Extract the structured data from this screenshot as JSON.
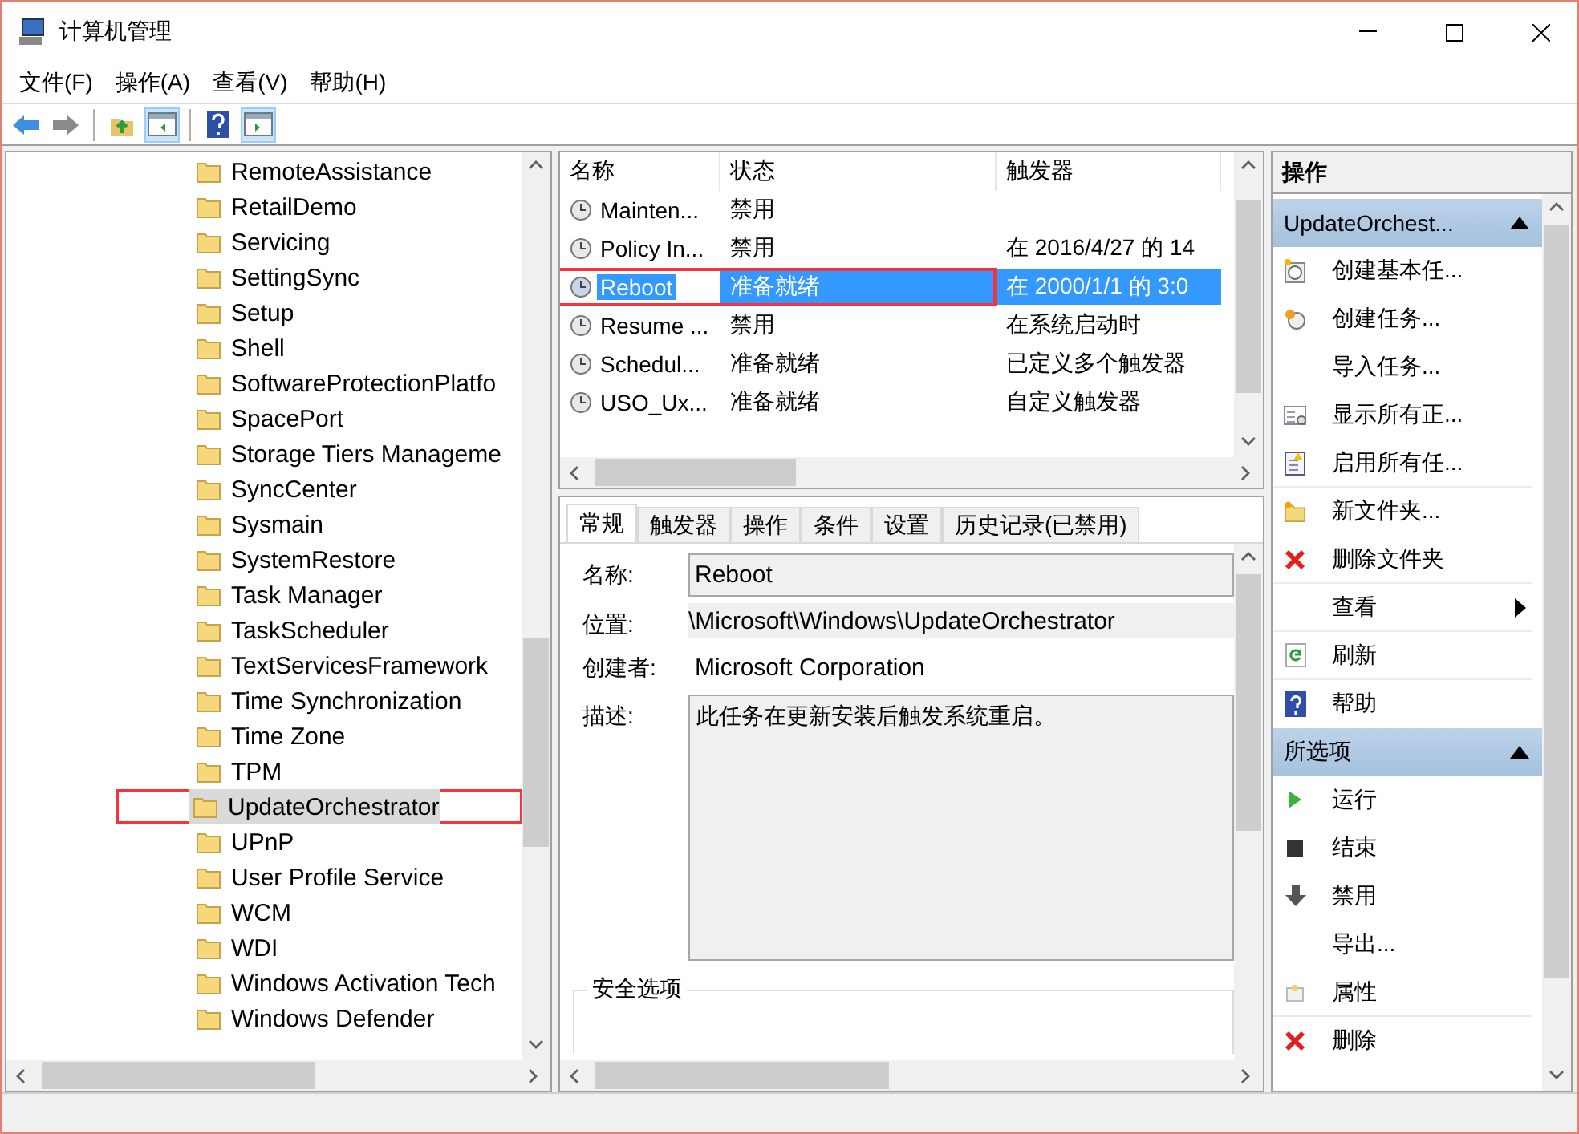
{
  "window": {
    "title": "计算机管理"
  },
  "menu": [
    "文件(F)",
    "操作(A)",
    "查看(V)",
    "帮助(H)"
  ],
  "toolbar": [
    {
      "pressed": false
    },
    {
      "pressed": false
    },
    {
      "pressed": false
    },
    {
      "pressed": true
    },
    {
      "pressed": false
    },
    {
      "pressed": true
    }
  ],
  "tree": {
    "items": [
      {
        "label": "RemoteAssistance",
        "selected": false,
        "annotated": false
      },
      {
        "label": "RetailDemo",
        "selected": false,
        "annotated": false
      },
      {
        "label": "Servicing",
        "selected": false,
        "annotated": false
      },
      {
        "label": "SettingSync",
        "selected": false,
        "annotated": false
      },
      {
        "label": "Setup",
        "selected": false,
        "annotated": false
      },
      {
        "label": "Shell",
        "selected": false,
        "annotated": false
      },
      {
        "label": "SoftwareProtectionPlatfo",
        "selected": false,
        "annotated": false
      },
      {
        "label": "SpacePort",
        "selected": false,
        "annotated": false
      },
      {
        "label": "Storage Tiers Manageme",
        "selected": false,
        "annotated": false
      },
      {
        "label": "SyncCenter",
        "selected": false,
        "annotated": false
      },
      {
        "label": "Sysmain",
        "selected": false,
        "annotated": false
      },
      {
        "label": "SystemRestore",
        "selected": false,
        "annotated": false
      },
      {
        "label": "Task Manager",
        "selected": false,
        "annotated": false
      },
      {
        "label": "TaskScheduler",
        "selected": false,
        "annotated": false
      },
      {
        "label": "TextServicesFramework",
        "selected": false,
        "annotated": false
      },
      {
        "label": "Time Synchronization",
        "selected": false,
        "annotated": false
      },
      {
        "label": "Time Zone",
        "selected": false,
        "annotated": false
      },
      {
        "label": "TPM",
        "selected": false,
        "annotated": false
      },
      {
        "label": "UpdateOrchestrator",
        "selected": true,
        "annotated": true
      },
      {
        "label": "UPnP",
        "selected": false,
        "annotated": false
      },
      {
        "label": "User Profile Service",
        "selected": false,
        "annotated": false
      },
      {
        "label": "WCM",
        "selected": false,
        "annotated": false
      },
      {
        "label": "WDI",
        "selected": false,
        "annotated": false
      },
      {
        "label": "Windows Activation Tech",
        "selected": false,
        "annotated": false
      },
      {
        "label": "Windows Defender",
        "selected": false,
        "annotated": false
      }
    ]
  },
  "task_list": {
    "columns": [
      "名称",
      "状态",
      "触发器"
    ],
    "rows": [
      {
        "name": "Mainten...",
        "status": "禁用",
        "trigger": "",
        "selected": false,
        "annotated": false
      },
      {
        "name": "Policy In...",
        "status": "禁用",
        "trigger": "在 2016/4/27 的 14",
        "selected": false,
        "annotated": false
      },
      {
        "name": "Reboot",
        "status": "准备就绪",
        "trigger": "在 2000/1/1 的 3:0",
        "selected": true,
        "annotated": true
      },
      {
        "name": "Resume ...",
        "status": "禁用",
        "trigger": "在系统启动时",
        "selected": false,
        "annotated": false
      },
      {
        "name": "Schedul...",
        "status": "准备就绪",
        "trigger": "已定义多个触发器",
        "selected": false,
        "annotated": false
      },
      {
        "name": "USO_Ux...",
        "status": "准备就绪",
        "trigger": "自定义触发器",
        "selected": false,
        "annotated": false
      }
    ]
  },
  "details": {
    "tabs": [
      {
        "label": "常规",
        "selected": true
      },
      {
        "label": "触发器",
        "selected": false
      },
      {
        "label": "操作",
        "selected": false
      },
      {
        "label": "条件",
        "selected": false
      },
      {
        "label": "设置",
        "selected": false
      },
      {
        "label": "历史记录(已禁用)",
        "selected": false
      }
    ],
    "fields": [
      {
        "label": "名称:",
        "value": "Reboot",
        "kind": "input"
      },
      {
        "label": "位置:",
        "value": "\\Microsoft\\Windows\\UpdateOrchestrator",
        "kind": "readonly"
      },
      {
        "label": "创建者:",
        "value": "Microsoft Corporation",
        "kind": "text"
      },
      {
        "label": "描述:",
        "value": "此任务在更新安装后触发系统重启。",
        "kind": "area"
      }
    ],
    "group_title": "安全选项"
  },
  "actions": {
    "title": "操作",
    "sections": [
      {
        "title": "UpdateOrchest...",
        "expanded": true,
        "items": [
          {
            "label": "创建基本任...",
            "submenu": false
          },
          {
            "label": "创建任务...",
            "submenu": false
          },
          {
            "label": "导入任务...",
            "submenu": false
          },
          {
            "label": "显示所有正...",
            "submenu": false
          },
          {
            "label": "启用所有任...",
            "submenu": false
          },
          {
            "label": "新文件夹...",
            "submenu": false
          },
          {
            "label": "删除文件夹",
            "submenu": false
          },
          {
            "label": "查看",
            "submenu": true
          },
          {
            "label": "刷新",
            "submenu": false
          },
          {
            "label": "帮助",
            "submenu": false
          }
        ]
      },
      {
        "title": "所选项",
        "expanded": true,
        "items": [
          {
            "label": "运行",
            "submenu": false
          },
          {
            "label": "结束",
            "submenu": false
          },
          {
            "label": "禁用",
            "submenu": false
          },
          {
            "label": "导出...",
            "submenu": false
          },
          {
            "label": "属性",
            "submenu": false
          },
          {
            "label": "删除",
            "submenu": false
          }
        ]
      }
    ]
  }
}
